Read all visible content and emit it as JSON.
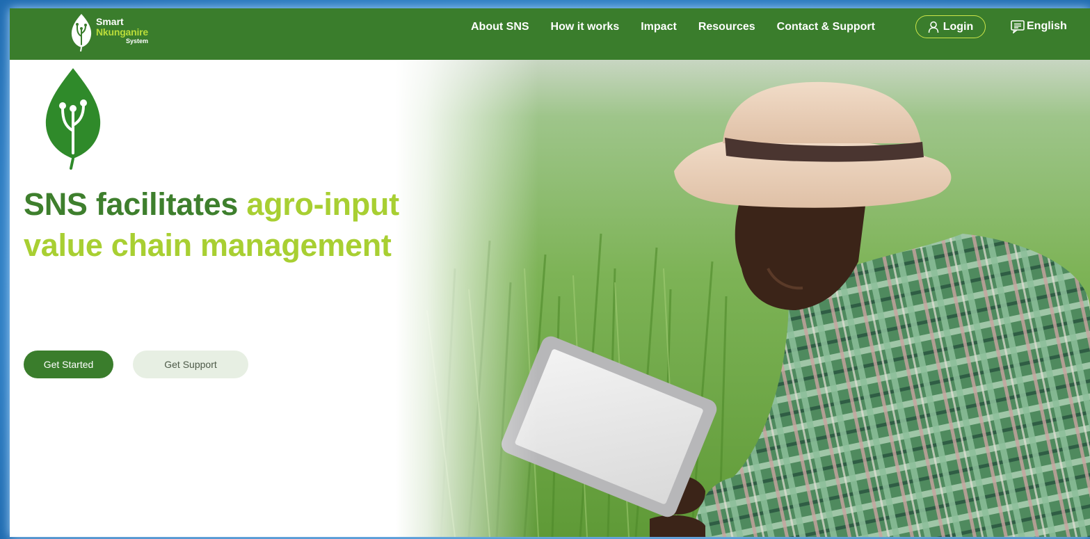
{
  "brand": {
    "line1": "Smart",
    "line2": "Nkunganire",
    "line3": "System"
  },
  "nav": {
    "links": [
      "About SNS",
      "How it works",
      "Impact",
      "Resources",
      "Contact & Support"
    ],
    "login_label": "Login",
    "language_label": "English"
  },
  "hero": {
    "headline_dark": "SNS facilitates ",
    "headline_light": "agro-input value chain management",
    "primary_button": "Get Started",
    "secondary_button": "Get Support"
  },
  "colors": {
    "brand_green": "#3a7d2c",
    "accent_lime": "#a8cf32",
    "screen_frame": "#2f7fc4"
  },
  "icons": [
    "leaf-logo-icon",
    "user-icon",
    "language-icon"
  ]
}
